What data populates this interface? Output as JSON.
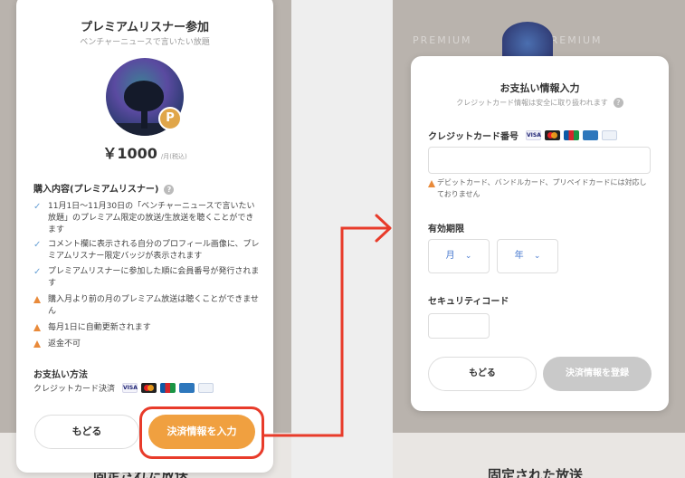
{
  "left_modal": {
    "title": "プレミアムリスナー参加",
    "subtitle": "ベンチャーニュースで言いたい放題",
    "badge_letter": "P",
    "price": "￥1000",
    "price_unit": "/月(税込)",
    "contents_heading": "購入内容(プレミアムリスナー)",
    "items": [
      {
        "icon": "check-icon",
        "text": "11月1日〜11月30日の「ベンチャーニュースで言いたい放題」のプレミアム限定の放送/生放送を聴くことができます"
      },
      {
        "icon": "check-icon",
        "text": "コメント欄に表示される自分のプロフィール画像に、プレミアムリスナー限定バッジが表示されます"
      },
      {
        "icon": "check-icon",
        "text": "プレミアムリスナーに参加した順に会員番号が発行されます"
      },
      {
        "icon": "warning-icon",
        "text": "購入月より前の月のプレミアム放送は聴くことができません"
      },
      {
        "icon": "warning-icon",
        "text": "毎月1日に自動更新されます"
      },
      {
        "icon": "warning-icon",
        "text": "返金不可"
      }
    ],
    "payment_heading": "お支払い方法",
    "payment_method": "クレジットカード決済",
    "back_label": "もどる",
    "proceed_label": "決済情報を入力"
  },
  "right_modal": {
    "title": "お支払い情報入力",
    "subtitle": "クレジットカード情報は安全に取り扱われます",
    "card_number_label": "クレジットカード番号",
    "card_note": "デビットカード、バンドルカード、プリペイドカードには対応しておりません",
    "expiry_label": "有効期限",
    "month_option": "月",
    "year_option": "年",
    "security_label": "セキュリティコード",
    "back_label": "もどる",
    "register_label": "決済情報を登録"
  },
  "background": {
    "left_footer": "固定された放送",
    "right_footer": "固定された放送",
    "watermark": "PREMIUM"
  },
  "card_brands": [
    "visa-icon",
    "mastercard-icon",
    "jcb-icon",
    "amex-icon",
    "diners-icon"
  ],
  "colors": {
    "accent_orange": "#f0a040",
    "highlight_red": "#e83b2a",
    "check_blue": "#6aa2d6",
    "warning_orange": "#e98a3a",
    "disabled_gray": "#c9c9c9"
  }
}
